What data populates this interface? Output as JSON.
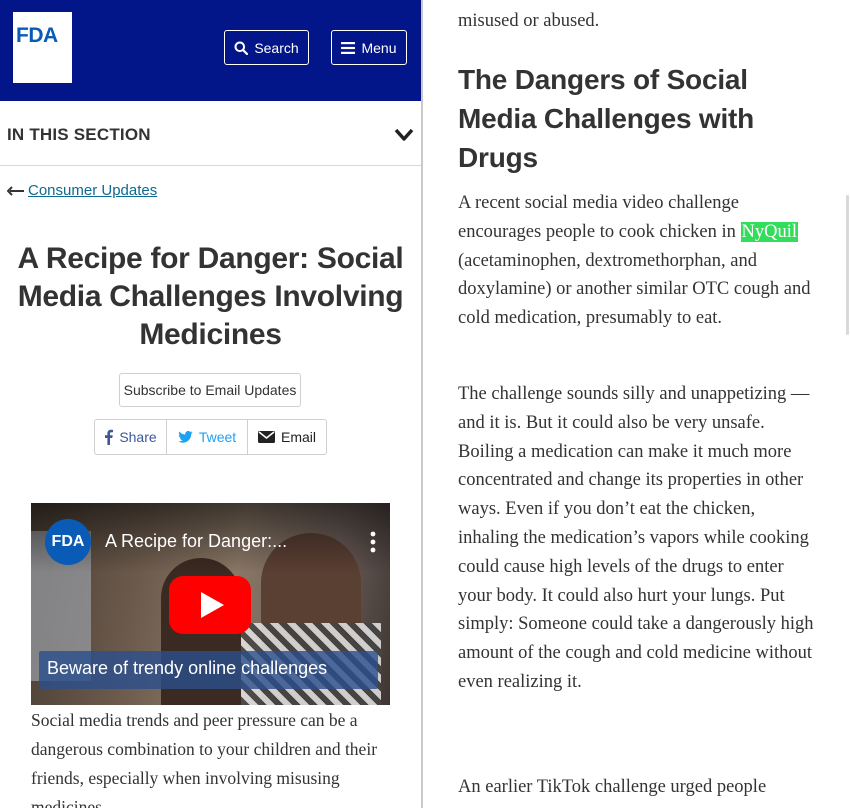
{
  "header": {
    "logo_text": "FDA",
    "search_label": "Search",
    "menu_label": "Menu",
    "bg_color": "#031689"
  },
  "section_nav": {
    "label": "IN THIS SECTION"
  },
  "breadcrumb": {
    "back_label": "Consumer Updates"
  },
  "article": {
    "title": "A Recipe for Danger: Social Media Challenges Involving Medicines",
    "subscribe_label": "Subscribe to Email Updates",
    "share": {
      "facebook": "Share",
      "twitter": "Tweet",
      "email": "Email"
    },
    "video": {
      "channel_badge": "FDA",
      "title": "A Recipe for Danger:...",
      "caption": "Beware of trendy online challenges"
    },
    "intro_text": "Social media trends and peer pressure can be a dangerous combination to your children and their friends, especially when involving misusing medicines."
  },
  "right_column": {
    "top_fragment_line1": "misused or abused.",
    "heading": "The Dangers of Social Media Challenges with Drugs",
    "para1_before": "A recent social media video challenge encourages people to cook chicken in ",
    "para1_highlight": "NyQuil",
    "para1_after": " (acetaminophen, dextromethorphan, and doxylamine) or another similar OTC cough and cold medication, presumably to eat.",
    "para2": "The challenge sounds silly and unappetizing — and it is. But it could also be very unsafe. Boiling a medication can make it much more concentrated and change its properties in other ways. Even if you don’t eat the chicken, inhaling the medication’s vapors while cooking could cause high levels of the drugs to enter your body. It could also hurt your lungs. Put simply: Someone could take a dangerously high amount of the cough and cold medicine without even realizing it.",
    "para3": "An earlier TikTok challenge urged people",
    "highlight_color": "#33dd5c"
  }
}
